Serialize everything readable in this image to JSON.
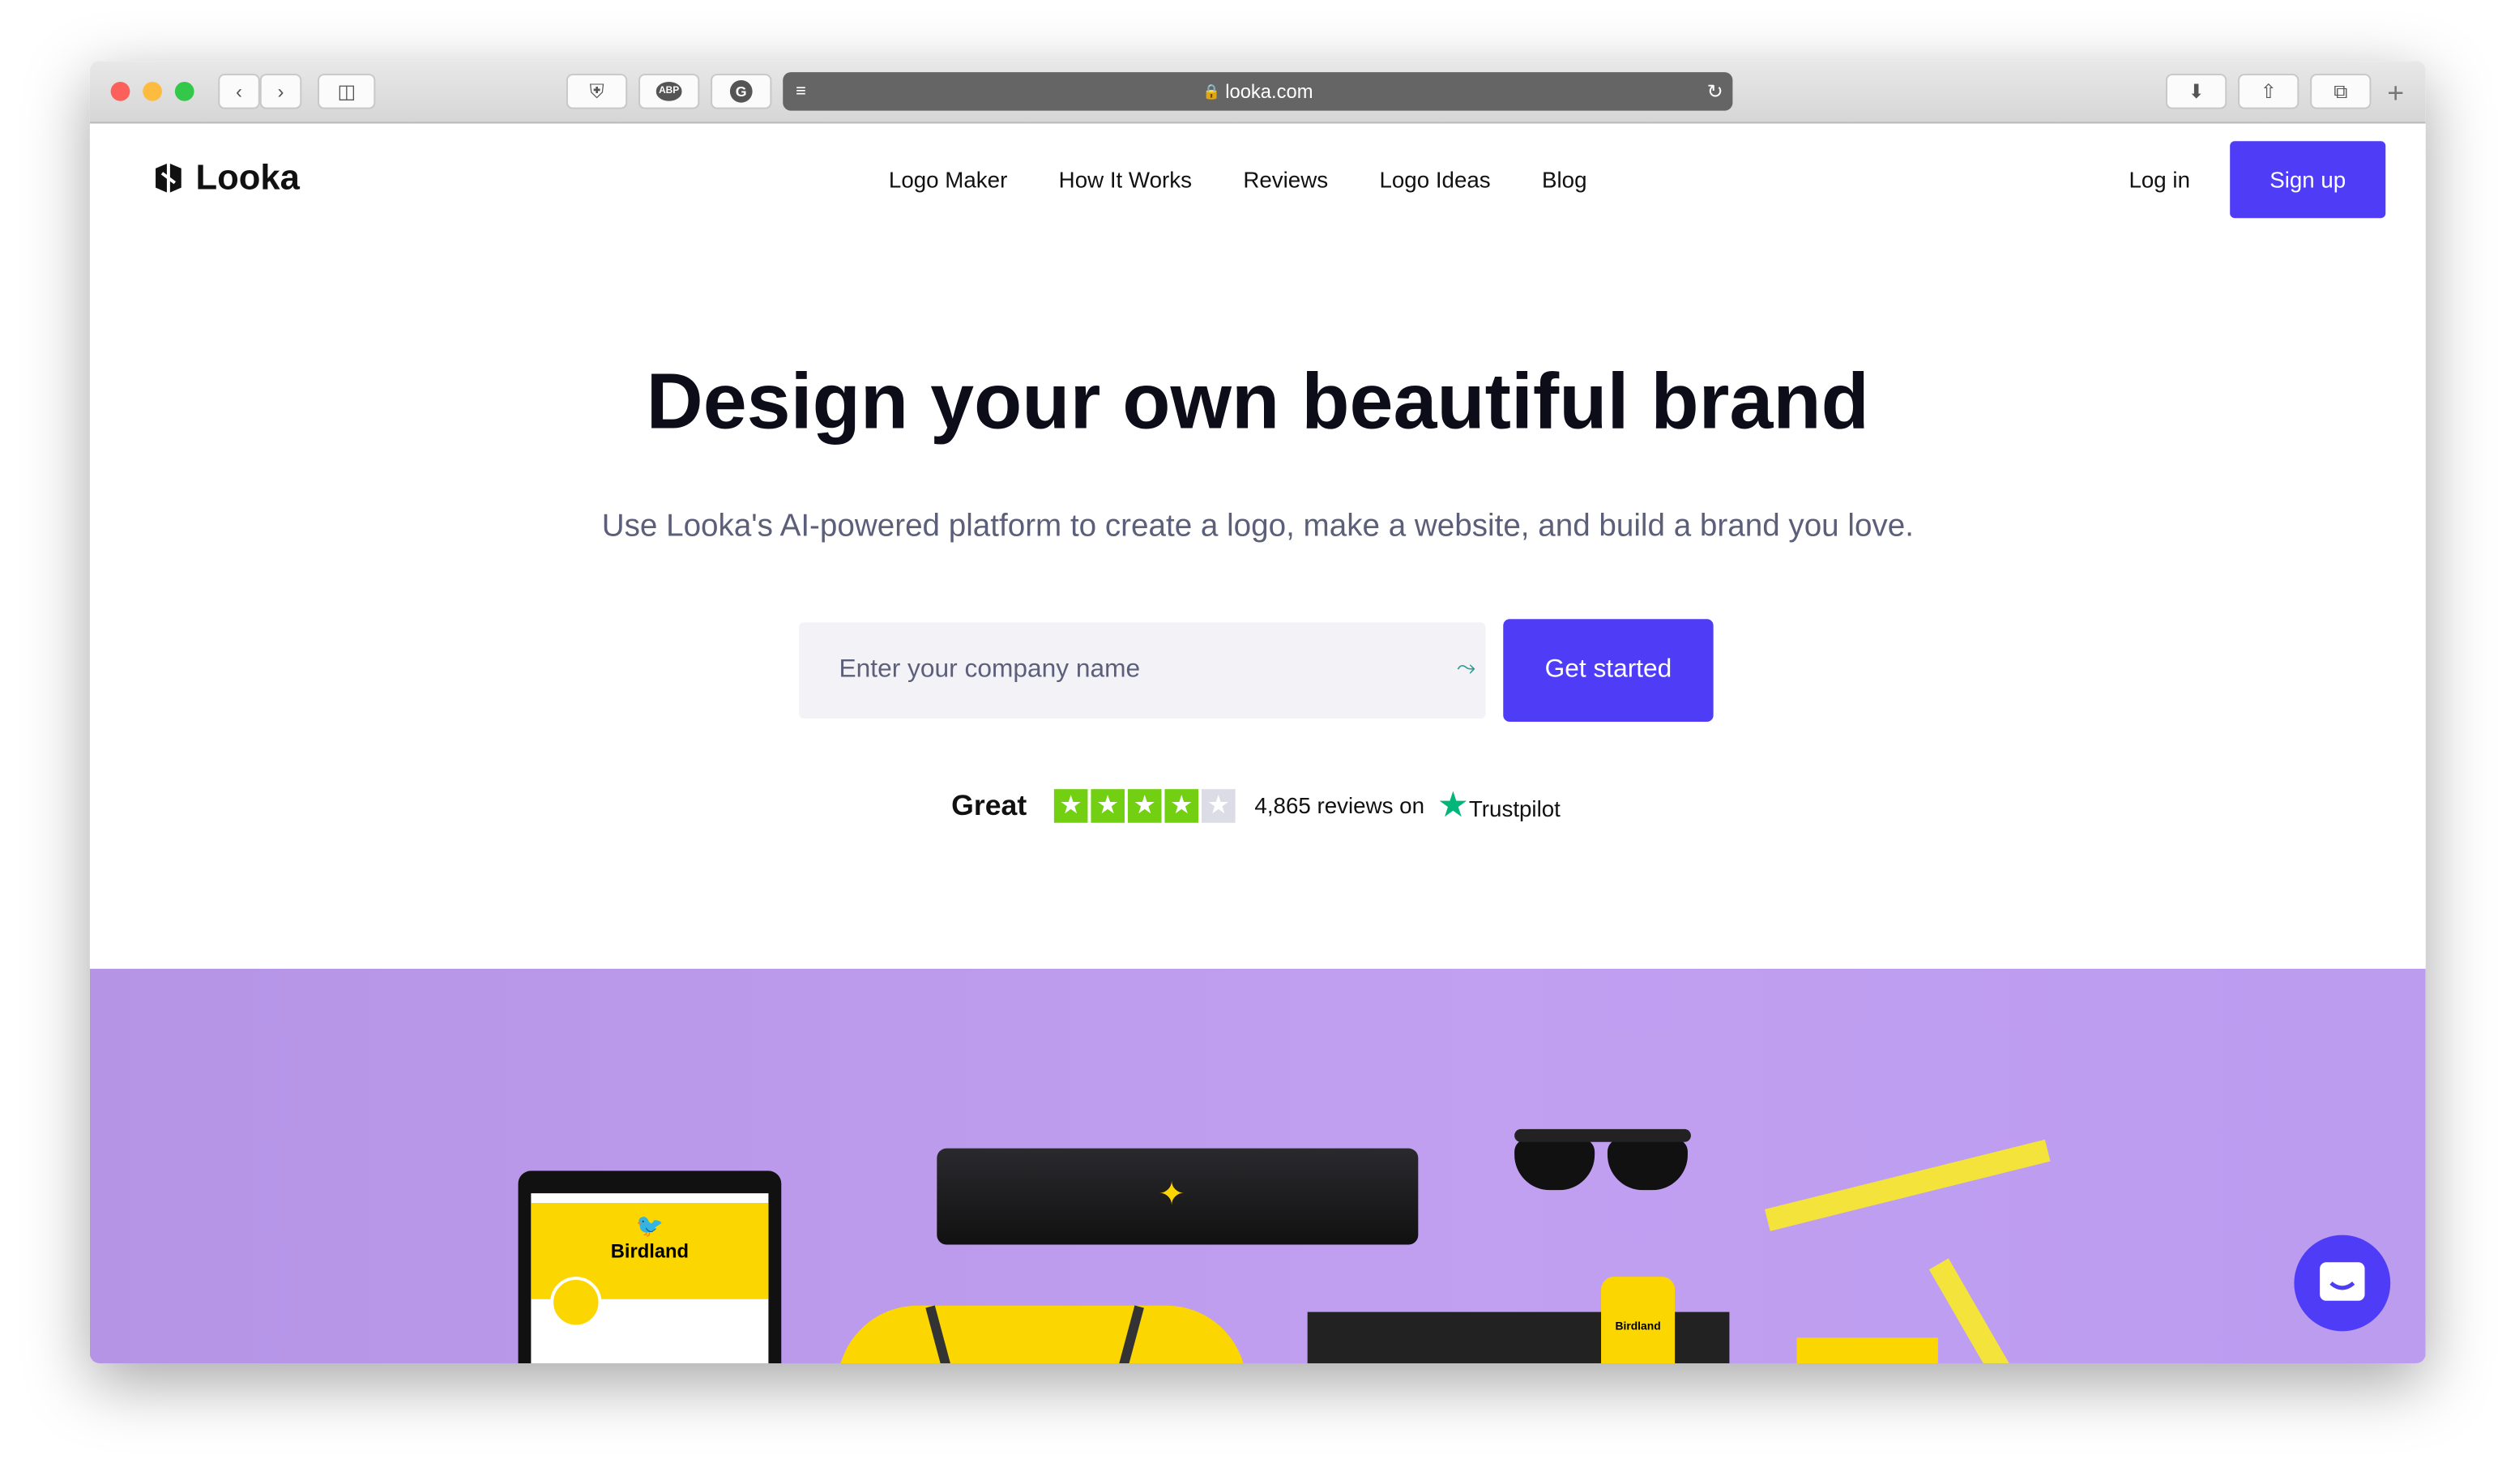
{
  "browser": {
    "url": "looka.com",
    "extensions": [
      "ABP",
      "G"
    ]
  },
  "nav": {
    "brand": "Looka",
    "links": [
      "Logo Maker",
      "How It Works",
      "Reviews",
      "Logo Ideas",
      "Blog"
    ],
    "login": "Log in",
    "signup": "Sign up"
  },
  "hero": {
    "title": "Design your own beautiful brand",
    "subtitle": "Use Looka's AI-powered platform to create a logo, make a website, and build a brand you love.",
    "input_placeholder": "Enter your company name",
    "cta": "Get started"
  },
  "trustpilot": {
    "rating_word": "Great",
    "stars": 4,
    "max_stars": 5,
    "reviews": "4,865 reviews on",
    "brand": "Trustpilot",
    "star_color": "#73cf11",
    "brand_color": "#00b67a"
  },
  "showcase": {
    "brand_name": "Birdland",
    "background": "#c09ff0",
    "accent": "#fcd600"
  },
  "colors": {
    "primary": "#4f3cf7"
  }
}
